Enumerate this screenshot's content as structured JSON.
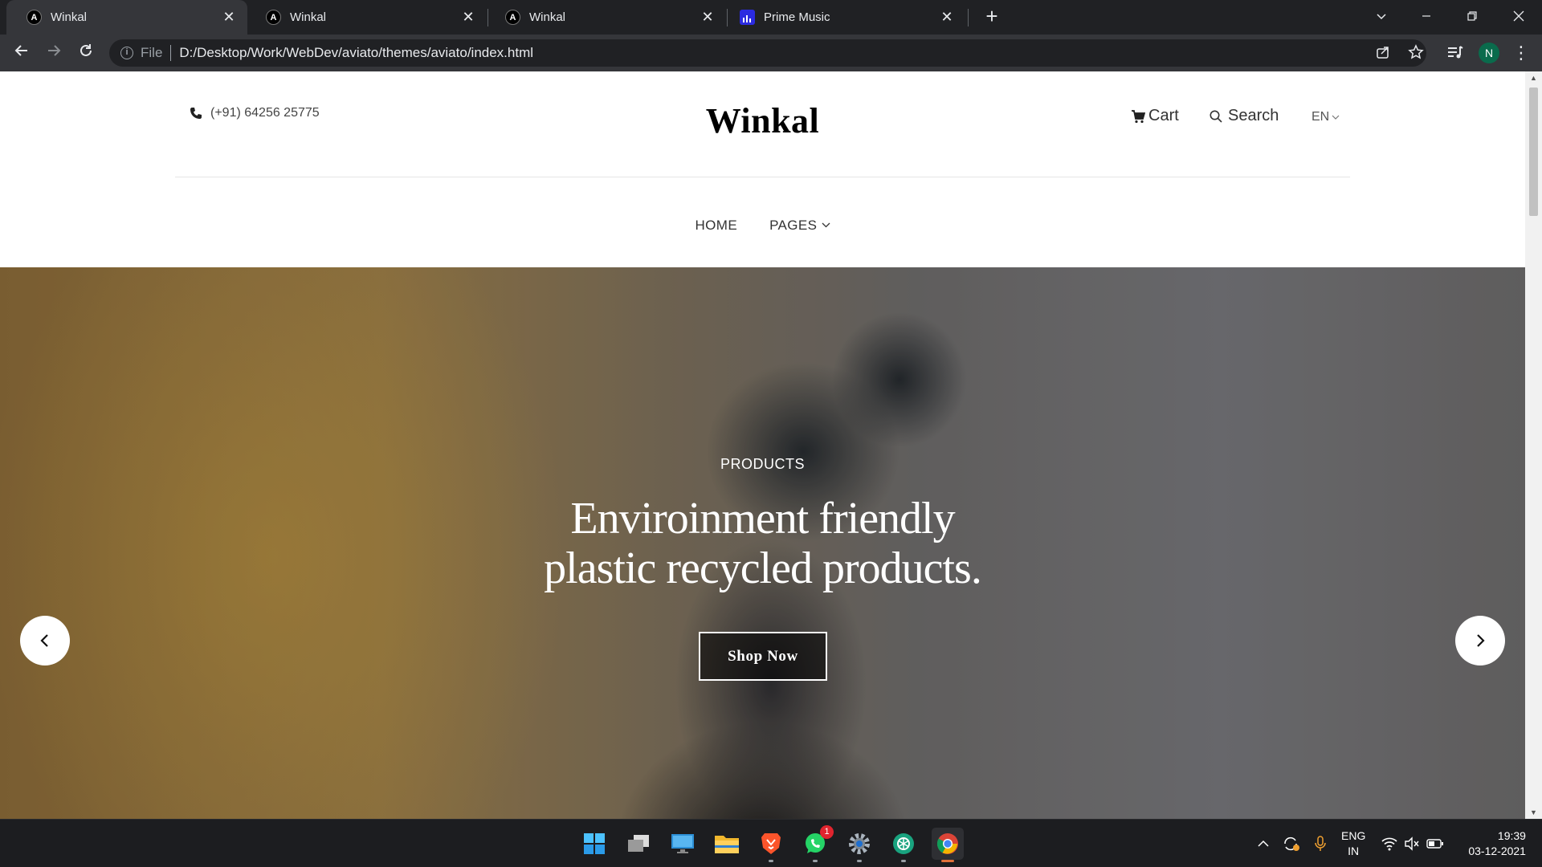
{
  "browser": {
    "tabs": [
      {
        "title": "Winkal",
        "favicon": "A",
        "active": true
      },
      {
        "title": "Winkal",
        "favicon": "A",
        "active": false
      },
      {
        "title": "Winkal",
        "favicon": "A",
        "active": false
      },
      {
        "title": "Prime Music",
        "favicon": "music",
        "active": false
      }
    ],
    "address": {
      "scheme": "File",
      "url": "D:/Desktop/Work/WebDev/aviato/themes/aviato/index.html"
    },
    "profile_initial": "N"
  },
  "site": {
    "phone": "(+91) 64256 25775",
    "logo": "Winkal",
    "cart_label": "Cart",
    "search_label": "Search",
    "language": "EN",
    "nav": {
      "home": "HOME",
      "pages": "PAGES"
    },
    "hero": {
      "kicker": "PRODUCTS",
      "title_line1": "Enviroinment friendly",
      "title_line2": "plastic recycled products.",
      "button": "Shop Now"
    }
  },
  "taskbar": {
    "apps": [
      "start",
      "task-view",
      "desktop",
      "file-explorer",
      "brave",
      "whatsapp",
      "settings",
      "chatgpt",
      "chrome"
    ],
    "whatsapp_badge": "1",
    "language_line1": "ENG",
    "language_line2": "IN",
    "time": "19:39",
    "date": "03-12-2021"
  }
}
